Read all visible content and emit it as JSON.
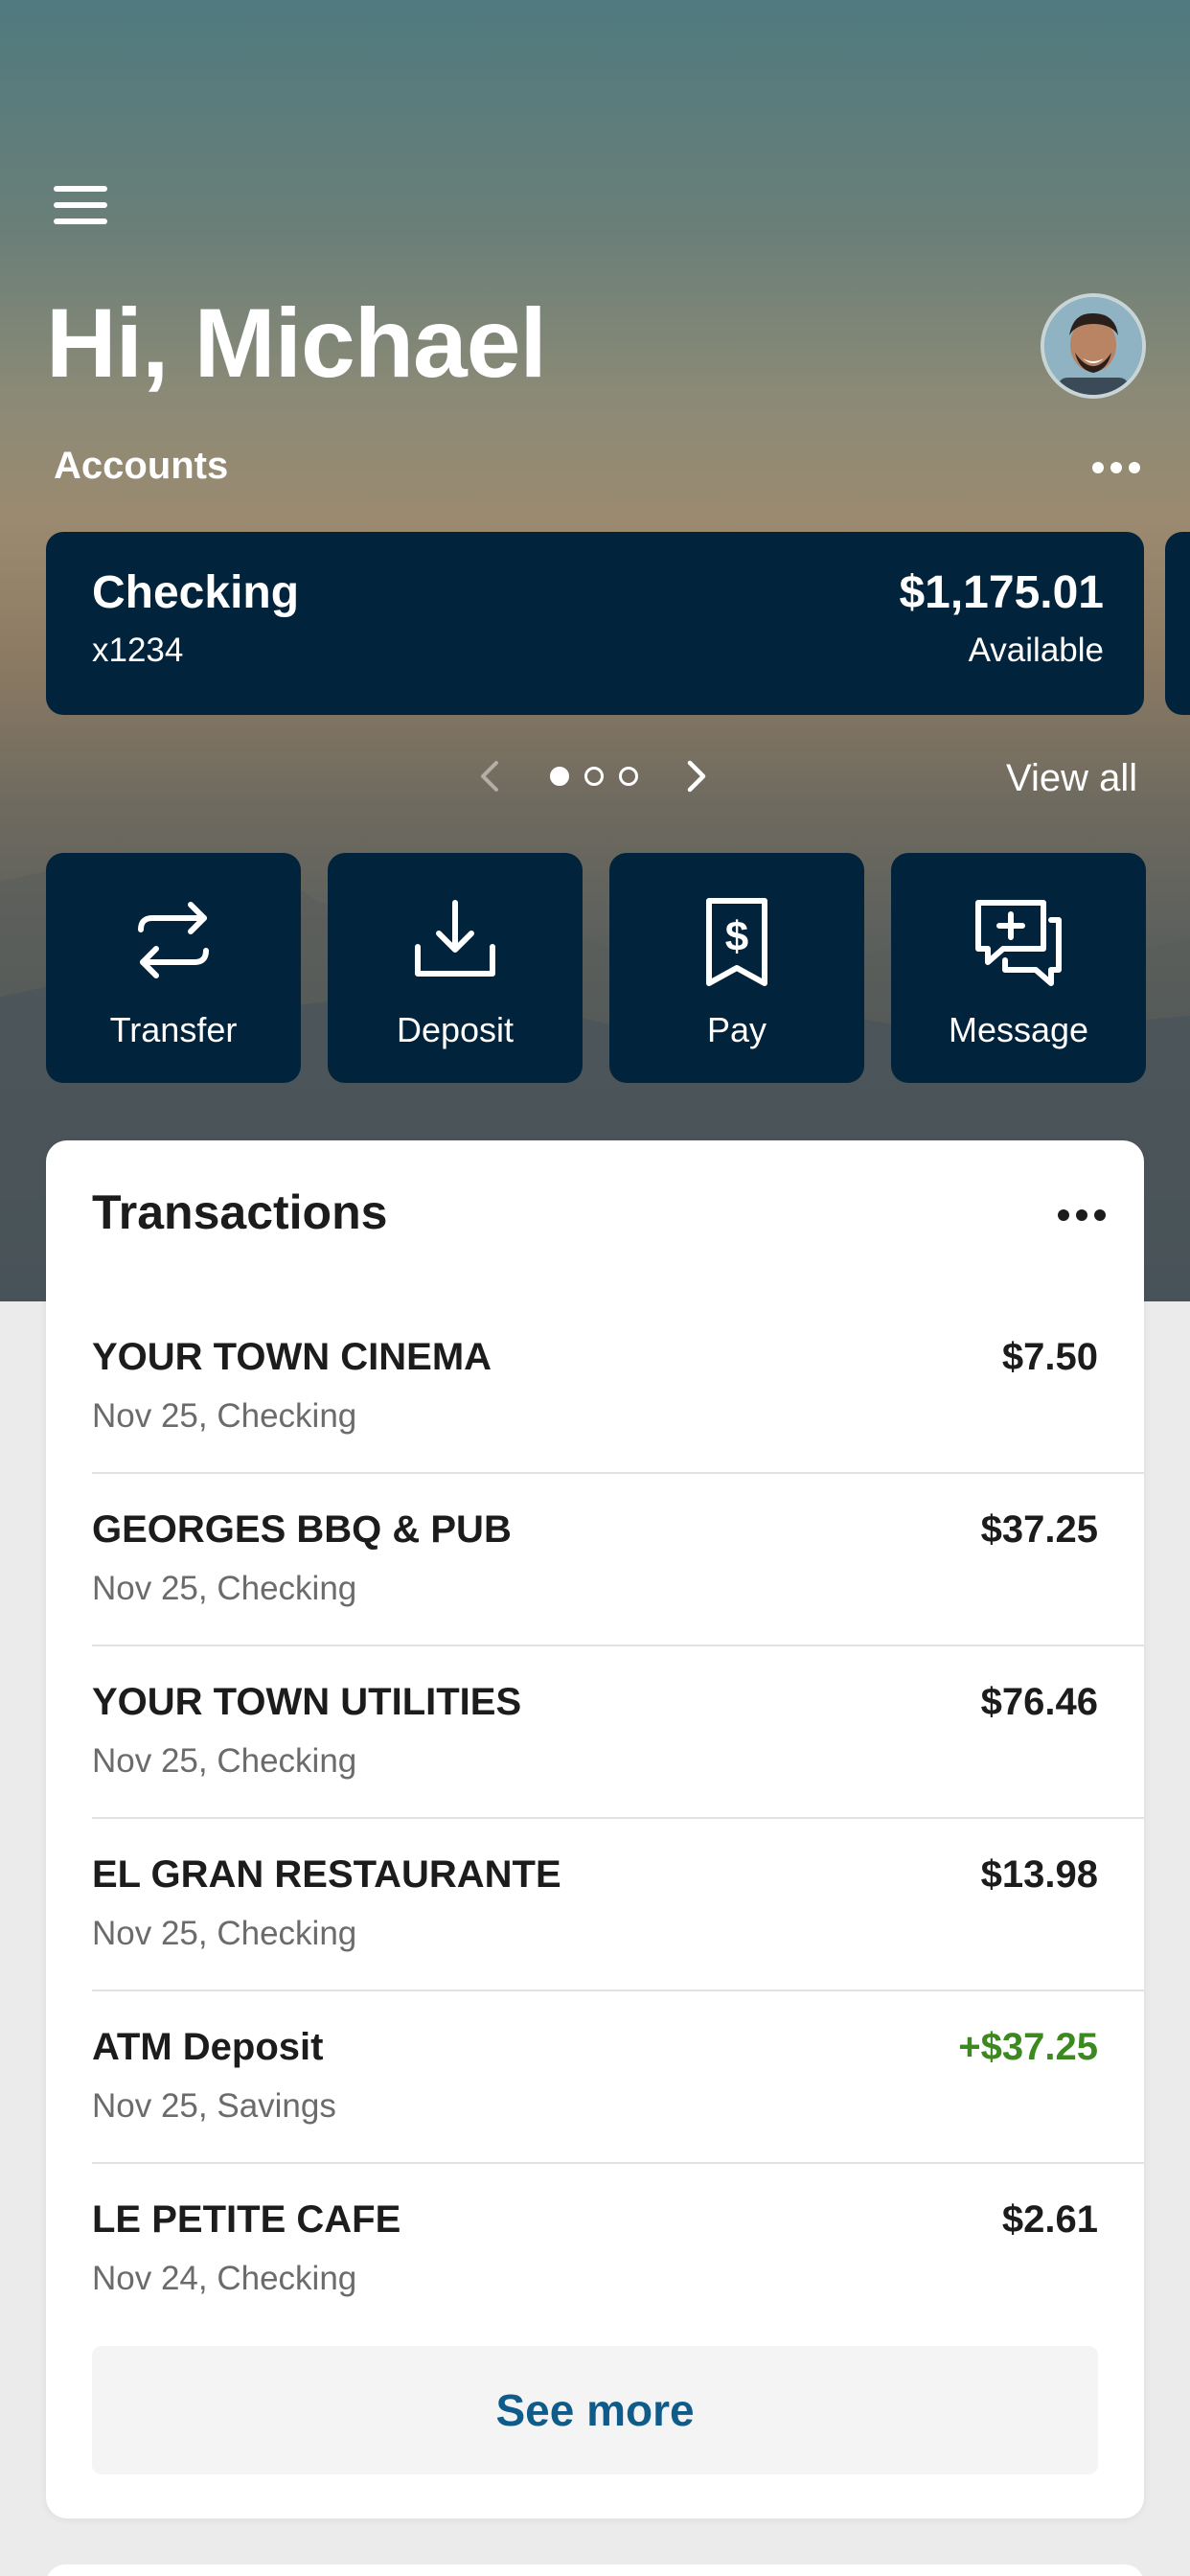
{
  "header": {
    "greeting": "Hi, Michael",
    "menu_icon": "hamburger-menu-icon",
    "avatar_icon": "profile-avatar"
  },
  "accounts": {
    "section_label": "Accounts",
    "more_icon": "more-horizontal-icon",
    "cards": [
      {
        "name": "Checking",
        "number": "x1234",
        "balance": "$1,175.01",
        "balance_label": "Available"
      }
    ],
    "pager": {
      "pages": 3,
      "active_page": 1
    },
    "view_all_label": "View all"
  },
  "actions": [
    {
      "label": "Transfer",
      "icon": "transfer-arrows-icon"
    },
    {
      "label": "Deposit",
      "icon": "download-tray-icon"
    },
    {
      "label": "Pay",
      "icon": "dollar-receipt-icon"
    },
    {
      "label": "Message",
      "icon": "chat-plus-icon"
    }
  ],
  "transactions": {
    "title": "Transactions",
    "items": [
      {
        "merchant": "YOUR TOWN CINEMA",
        "meta": "Nov 25, Checking",
        "amount": "$7.50",
        "credit": false
      },
      {
        "merchant": "GEORGES BBQ & PUB",
        "meta": "Nov 25, Checking",
        "amount": "$37.25",
        "credit": false
      },
      {
        "merchant": "YOUR TOWN UTILITIES",
        "meta": "Nov 25, Checking",
        "amount": "$76.46",
        "credit": false
      },
      {
        "merchant": "EL GRAN RESTAURANTE",
        "meta": "Nov 25, Checking",
        "amount": "$13.98",
        "credit": false
      },
      {
        "merchant": "ATM Deposit",
        "meta": "Nov 25, Savings",
        "amount": "+$37.25",
        "credit": true
      },
      {
        "merchant": "LE PETITE CAFE",
        "meta": "Nov 24, Checking",
        "amount": "$2.61",
        "credit": false
      }
    ],
    "see_more_label": "See more"
  },
  "colors": {
    "card_navy": "#01233b",
    "credit_green": "#3c8a1f",
    "link_blue": "#0f5b8a"
  }
}
